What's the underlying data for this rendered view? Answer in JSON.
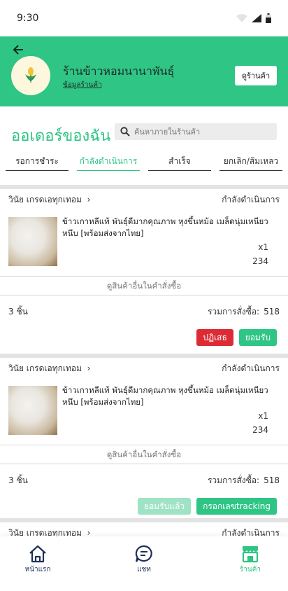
{
  "status": {
    "time": "9:30"
  },
  "header": {
    "shop_name": "ร้านข้าวหอมนานาพันธุ์",
    "shop_info": "ข้อมูลร้านค้า",
    "visit_shop": "ดูร้านค้า"
  },
  "main": {
    "title": "ออเดอร์ของฉัน",
    "search_placeholder": "ค้นหาภายในร้านค้า",
    "tabs": [
      {
        "label": "รอการชำระ"
      },
      {
        "label": "กำลังดำเนินการ"
      },
      {
        "label": "สำเร็จ"
      },
      {
        "label": "ยกเลิก/ส้มเหลว"
      }
    ]
  },
  "orders": [
    {
      "customer": "วินัย เกรดเอทุกเทอม",
      "status": "กำลังดำเนินการ",
      "product_name": "ข้าวเกาหลีแท้ พันธุ์ดีมากคุณภาพ หุงขึ้นหม้อ  เมล็ดนุ่มเหนียวหนึบ [พร้อมส่งจากไทย]",
      "quantity": "x1",
      "price": "234",
      "see_more": "ดูสินค้าอื่นในคำสั่งซื้อ",
      "item_count": "3 ชิ้น",
      "total_label": "รวมการสั่งซื้อ:",
      "total_value": "518",
      "reject_label": "ปฏิเสธ",
      "accept_label": "ยอมรับ"
    },
    {
      "customer": "วินัย เกรดเอทุกเทอม",
      "status": "กำลังดำเนินการ",
      "product_name": "ข้าวเกาหลีแท้ พันธุ์ดีมากคุณภาพ หุงขึ้นหม้อ  เมล็ดนุ่มเหนียวหนึบ [พร้อมส่งจากไทย]",
      "quantity": "x1",
      "price": "234",
      "see_more": "ดูสินค้าอื่นในคำสั่งซื้อ",
      "item_count": "3 ชิ้น",
      "total_label": "รวมการสั่งซื้อ:",
      "total_value": "518",
      "accepted_label": "ยอมรับแล้ว",
      "tracking_label": "กรอกเลขtracking"
    },
    {
      "customer": "วินัย เกรดเอทุกเทอม",
      "status": "กำลังดำเนินการ"
    }
  ],
  "bottom_nav": [
    {
      "label": "หน้าแรก",
      "icon": "home-icon"
    },
    {
      "label": "แชท",
      "icon": "chat-icon"
    },
    {
      "label": "ร้านค้า",
      "icon": "store-icon"
    }
  ],
  "colors": {
    "brand": "#2ec585",
    "danger": "#dc2b35",
    "nav": "#1e2f5c"
  }
}
